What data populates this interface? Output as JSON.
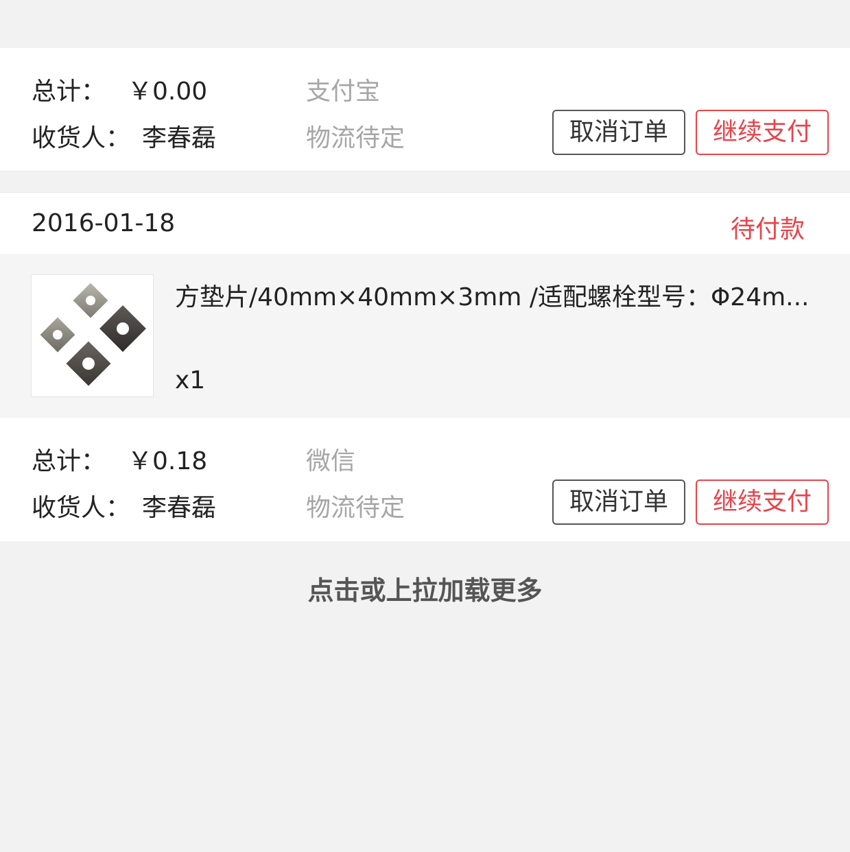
{
  "orders": [
    {
      "total_label": "总计：",
      "total_value": "￥0.00",
      "payment_method": "支付宝",
      "recipient_label": "收货人：",
      "recipient_name": "李春磊",
      "logistics": "物流待定",
      "cancel_label": "取消订单",
      "pay_label": "继续支付"
    },
    {
      "date": "2016-01-18",
      "status": "待付款",
      "product": {
        "title": "方垫片/40mm×40mm×3mm /适配螺栓型号：Φ24m...",
        "quantity": "x1"
      },
      "total_label": "总计：",
      "total_value": "￥0.18",
      "payment_method": "微信",
      "recipient_label": "收货人：",
      "recipient_name": "李春磊",
      "logistics": "物流待定",
      "cancel_label": "取消订单",
      "pay_label": "继续支付"
    }
  ],
  "load_more": "点击或上拉加载更多",
  "colors": {
    "accent": "#e8434b",
    "muted_text": "#a6a6a6",
    "background": "#f2f2f2"
  }
}
